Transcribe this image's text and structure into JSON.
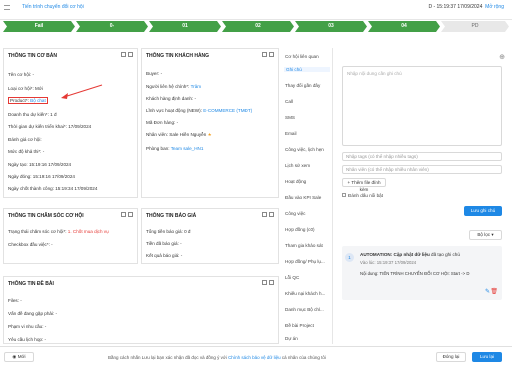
{
  "header": {
    "crumb": "Tiến trình chuyển đổi cơ hội",
    "record": "D - 15:19:37 17/09/2024",
    "manage_link": "Mở rộng"
  },
  "stages": [
    {
      "label": "Fail",
      "state": "done"
    },
    {
      "label": "0-",
      "state": "done"
    },
    {
      "label": "01",
      "state": "done"
    },
    {
      "label": "02",
      "state": "done"
    },
    {
      "label": "03",
      "state": "done"
    },
    {
      "label": "04",
      "state": "done"
    },
    {
      "label": "PD",
      "state": "todo"
    }
  ],
  "basic": {
    "title": "THÔNG TIN CƠ BẢN",
    "rows": [
      {
        "label": "Tên cơ hội: ",
        "value": "-"
      },
      {
        "label": "Loại cơ hội*: ",
        "value": "Mới"
      },
      {
        "label": "Product*: ",
        "value": "Bộ chat"
      },
      {
        "label": "Doanh thu dự kiến*: ",
        "value": "1 đ"
      },
      {
        "label": "Thời gian dự kiến triển khai*: ",
        "value": "17/09/2024"
      },
      {
        "label": "Đánh giá cơ hội: ",
        "value": ""
      },
      {
        "label": "Mức độ khả thi*: ",
        "value": "-"
      },
      {
        "label": "Ngày tạo: ",
        "value": "15:19:16 17/09/2024"
      },
      {
        "label": "Ngày đóng: ",
        "value": "15:19:16 17/09/2024"
      },
      {
        "label": "Ngày chốt thành công: ",
        "value": "15:19:34 17/09/2024"
      }
    ]
  },
  "customer": {
    "title": "THÔNG TIN KHÁCH HÀNG",
    "rows": [
      {
        "label": "Buyer: ",
        "value": "-"
      },
      {
        "label": "Người liên hệ chính*: ",
        "value": "Trâm"
      },
      {
        "label": "Khách hàng định danh: ",
        "value": "-"
      },
      {
        "label": "Lĩnh vực hoạt động (NEW): ",
        "value": "E-COMMERCE (TMĐT)"
      },
      {
        "label": "Mã Đơn hàng: ",
        "value": "-"
      },
      {
        "label": "Nhân viên: ",
        "value": "Sale Hiền Nguyễn"
      },
      {
        "label": "Phòng ban: ",
        "value": "Team sale_HN1"
      }
    ]
  },
  "care": {
    "title": "THÔNG TIN CHĂM SÓC CƠ HỘI",
    "rows": [
      {
        "label": "Trạng thái chăm sóc cơ hội*: ",
        "value": "1. Chốt mua dịch vụ"
      },
      {
        "label": "Checkbox đầu việc*: ",
        "value": "-"
      }
    ]
  },
  "quote": {
    "title": "THÔNG TIN BÁO GIÁ",
    "rows": [
      {
        "label": "Tổng tiền báo giá: ",
        "value": "0 đ"
      },
      {
        "label": "Tiền đã báo giá: ",
        "value": "-"
      },
      {
        "label": "Kết quả báo giá: ",
        "value": "-"
      }
    ]
  },
  "issue": {
    "title": "THÔNG TIN ĐỀ BÀI",
    "rows": [
      {
        "label": "Files: ",
        "value": "-"
      },
      {
        "label": "Vấn đề đang gặp phải: ",
        "value": "-"
      },
      {
        "label": "Phạm vi nhu cầu: ",
        "value": "-"
      },
      {
        "label": "Yêu cầu lịch họp: ",
        "value": "-"
      }
    ]
  },
  "tabs": [
    "Cơ hội liên quan",
    "Ghi chú",
    "Thay đổi gần đây",
    "Call",
    "SMS",
    "Email",
    "Công việc, lịch hẹn",
    "Lịch sử xem",
    "Hoạt động",
    "Đầu vào KPI Sale",
    "Công việc",
    "Hợp đồng (c0)",
    "Tham gia khảo sát",
    "Hợp đồng/ Phụ lụ...",
    "Lỗi QC",
    "Khiếu nại khách h...",
    "Danh mục Bộ chỉ...",
    "Đề bài Project",
    "Dự án"
  ],
  "note": {
    "placeholder": "Nhập nội dung cần ghi chú",
    "tags_placeholder": "Nhập tags (có thể nhập nhiều tags)",
    "staff_placeholder": "Nhân viên (có thể nhập nhiều nhân viên)",
    "attach_label": "Thêm file đính kèm",
    "pin_label": "Đánh dấu nổi bật",
    "save_label": "Lưu ghi chú",
    "filter_label": "Bộ lọc",
    "log_index": "1",
    "log_title": "AUTOMATION: Cập nhật dữ liệu",
    "log_suffix": "đã tạo ghi chú",
    "log_time": "Vào lúc: 15:19:37 17/09/2024",
    "log_body": "Nội dung: TIẾN TRÌNH CHUYỂN ĐỔI CƠ HỘI: Start -> D"
  },
  "footer": {
    "watch_label": "Mới",
    "notice": "Bằng cách nhấn Lưu lại bạn xác nhận đã đọc và đồng ý với",
    "policy_link": "Chính sách bảo vệ dữ liệu",
    "notice_tail": "cá nhân của chúng tôi",
    "close_label": "Đóng lại",
    "save_label": "Lưu lại"
  },
  "colors": {
    "accent": "#1e88e5",
    "stage_done": "#43a047",
    "warning": "#e53935"
  }
}
